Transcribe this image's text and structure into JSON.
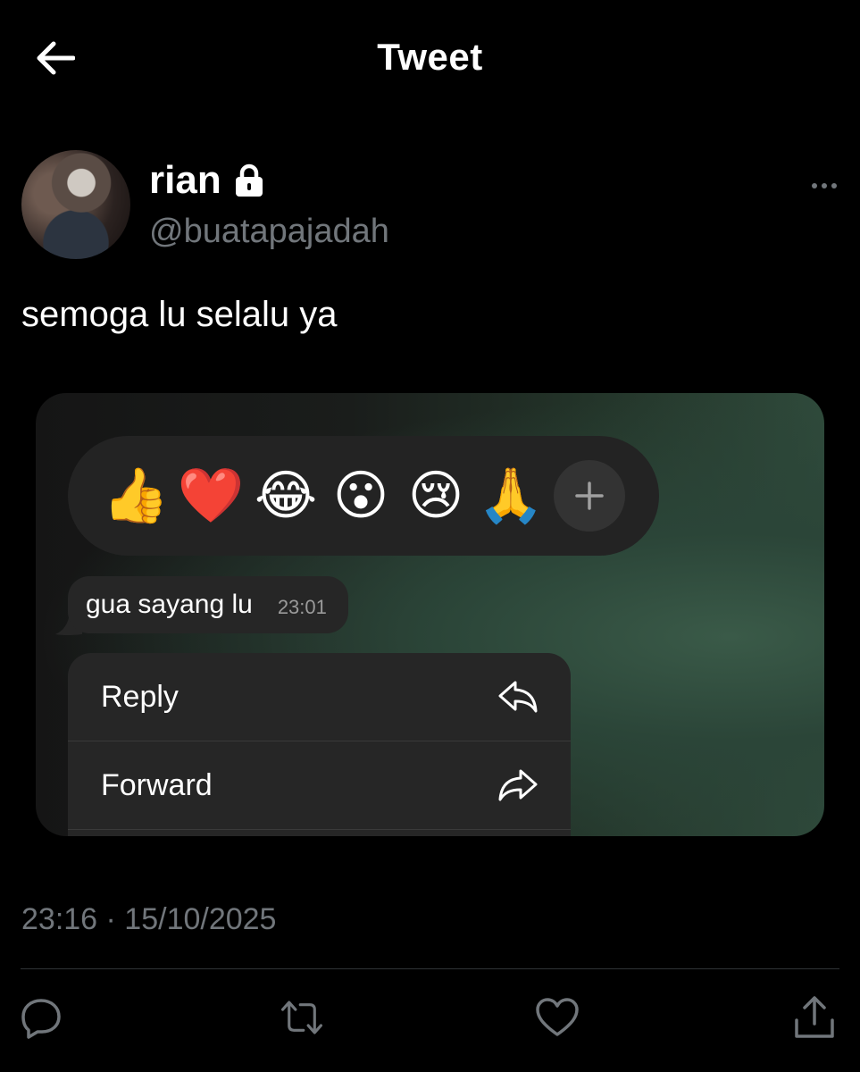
{
  "header": {
    "title": "Tweet",
    "back_icon": "arrow-left-icon"
  },
  "author": {
    "name": "rian",
    "handle": "@buatapajadah",
    "locked_icon": "lock-icon",
    "more_icon": "more-horizontal-icon"
  },
  "tweet": {
    "text": "semoga lu selalu ya",
    "timestamp": "23:16 · 15/10/2025"
  },
  "media": {
    "reactions": [
      "👍",
      "❤️",
      "😂",
      "😮",
      "😢",
      "🙏"
    ],
    "add_reaction_icon": "plus-icon",
    "message": {
      "text": "gua sayang lu",
      "time": "23:01"
    },
    "menu": [
      {
        "label": "Reply",
        "icon": "reply-icon"
      },
      {
        "label": "Forward",
        "icon": "forward-icon"
      }
    ]
  },
  "actions": [
    {
      "name": "reply",
      "icon": "comment-icon"
    },
    {
      "name": "retweet",
      "icon": "retweet-icon"
    },
    {
      "name": "like",
      "icon": "heart-icon"
    },
    {
      "name": "share",
      "icon": "share-icon"
    }
  ],
  "colors": {
    "background": "#000000",
    "text": "#ffffff",
    "secondary": "#71767b",
    "menu_bg": "#262626"
  }
}
